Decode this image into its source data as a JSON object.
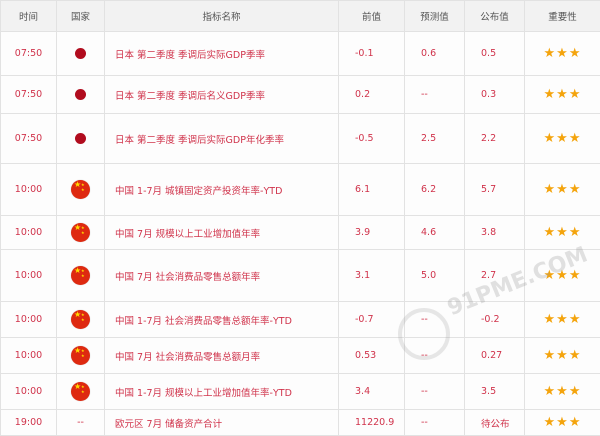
{
  "columns": {
    "time": "时间",
    "country": "国家",
    "name": "指标名称",
    "previous": "前值",
    "forecast": "预测值",
    "actual": "公布值",
    "importance": "重要性"
  },
  "rows": [
    {
      "time": "07:50",
      "country": "japan-flag-icon",
      "name": "日本 第二季度 季调后实际GDP季率",
      "previous": "-0.1",
      "forecast": "0.6",
      "actual": "0.5",
      "stars": "★★★"
    },
    {
      "time": "07:50",
      "country": "japan-flag-icon",
      "name": "日本 第二季度 季调后名义GDP季率",
      "previous": "0.2",
      "forecast": "--",
      "actual": "0.3",
      "stars": "★★★"
    },
    {
      "time": "07:50",
      "country": "japan-flag-icon",
      "name": "日本 第二季度 季调后实际GDP年化季率",
      "previous": "-0.5",
      "forecast": "2.5",
      "actual": "2.2",
      "stars": "★★★"
    },
    {
      "time": "10:00",
      "country": "china-flag-icon",
      "name": "中国 1-7月 城镇固定资产投资年率-YTD",
      "previous": "6.1",
      "forecast": "6.2",
      "actual": "5.7",
      "stars": "★★★"
    },
    {
      "time": "10:00",
      "country": "china-flag-icon",
      "name": "中国 7月 规模以上工业增加值年率",
      "previous": "3.9",
      "forecast": "4.6",
      "actual": "3.8",
      "stars": "★★★"
    },
    {
      "time": "10:00",
      "country": "china-flag-icon",
      "name": "中国 7月 社会消费品零售总额年率",
      "previous": "3.1",
      "forecast": "5.0",
      "actual": "2.7",
      "stars": "★★★"
    },
    {
      "time": "10:00",
      "country": "china-flag-icon",
      "name": "中国 1-7月 社会消费品零售总额年率-YTD",
      "previous": "-0.7",
      "forecast": "--",
      "actual": "-0.2",
      "stars": "★★★"
    },
    {
      "time": "10:00",
      "country": "china-flag-icon",
      "name": "中国 7月 社会消费品零售总额月率",
      "previous": "0.53",
      "forecast": "--",
      "actual": "0.27",
      "stars": "★★★"
    },
    {
      "time": "10:00",
      "country": "china-flag-icon",
      "name": "中国 1-7月 规模以上工业增加值年率-YTD",
      "previous": "3.4",
      "forecast": "--",
      "actual": "3.5",
      "stars": "★★★"
    },
    {
      "time": "19:00",
      "country": "--",
      "name": "欧元区 7月 储备资产合计",
      "previous": "11220.9",
      "forecast": "--",
      "actual": "待公布",
      "stars": "★★★"
    }
  ],
  "watermark": {
    "text": "91PME.COM"
  },
  "colors": {
    "value_text": "#d0334b",
    "star": "#f4a40d",
    "header_bg": "#f2f2f2"
  }
}
